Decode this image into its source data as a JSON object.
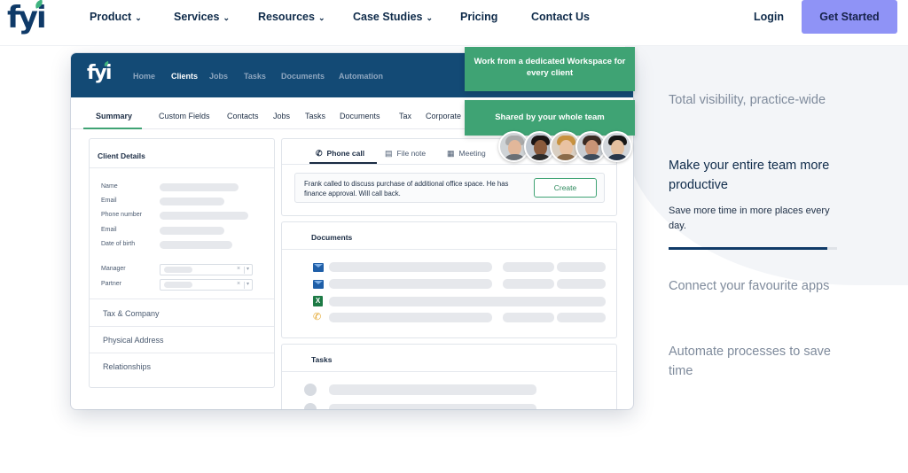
{
  "brand": {
    "logo_text": "fyi"
  },
  "nav": {
    "items": [
      {
        "label": "Product",
        "has_dropdown": true
      },
      {
        "label": "Services",
        "has_dropdown": true
      },
      {
        "label": "Resources",
        "has_dropdown": true
      },
      {
        "label": "Case Studies",
        "has_dropdown": true
      },
      {
        "label": "Pricing",
        "has_dropdown": false
      },
      {
        "label": "Contact Us",
        "has_dropdown": false
      }
    ],
    "login": "Login",
    "cta": "Get Started",
    "cta_color": "#8f93f6"
  },
  "app": {
    "logo_text": "fyi",
    "nav": [
      "Home",
      "Clients",
      "Jobs",
      "Tasks",
      "Documents",
      "Automation"
    ],
    "active_nav": "Clients",
    "subtabs": [
      "Summary",
      "Custom Fields",
      "Contacts",
      "Jobs",
      "Tasks",
      "Documents",
      "Tax",
      "Corporate"
    ],
    "active_subtab": "Summary",
    "client_details": {
      "title": "Client Details",
      "fields": [
        "Name",
        "Email",
        "Phone number",
        "Email",
        "Date of birth"
      ],
      "select_fields": [
        "Manager",
        "Partner"
      ],
      "sections": [
        "Tax & Company",
        "Physical Address",
        "Relationships"
      ]
    },
    "activity": {
      "tabs": [
        {
          "label": "Phone call",
          "icon": "phone-icon"
        },
        {
          "label": "File note",
          "icon": "file-note-icon"
        },
        {
          "label": "Meeting",
          "icon": "calendar-icon"
        }
      ],
      "active_tab": "Phone call",
      "note_text": "Frank called to discuss purchase of additional office space. He has finance approval. Will call back.",
      "create_label": "Create"
    },
    "documents": {
      "title": "Documents",
      "rows": [
        {
          "icon": "email-icon"
        },
        {
          "icon": "email-icon"
        },
        {
          "icon": "excel-icon",
          "glyph": "X"
        },
        {
          "icon": "phone-icon"
        }
      ]
    },
    "tasks": {
      "title": "Tasks"
    }
  },
  "callouts": {
    "dedicated_workspace": "Work from a dedicated Workspace for every client",
    "shared": "Shared by your whole team",
    "color": "#3fa374"
  },
  "features": [
    {
      "title": "Total visibility, practice-wide",
      "active": false
    },
    {
      "title": "Make your entire team more productive",
      "active": true,
      "description": "Save more time in more places every day.",
      "progress": 0.94
    },
    {
      "title": "Connect your favourite apps",
      "active": false
    },
    {
      "title": "Automate processes to save time",
      "active": false
    }
  ]
}
